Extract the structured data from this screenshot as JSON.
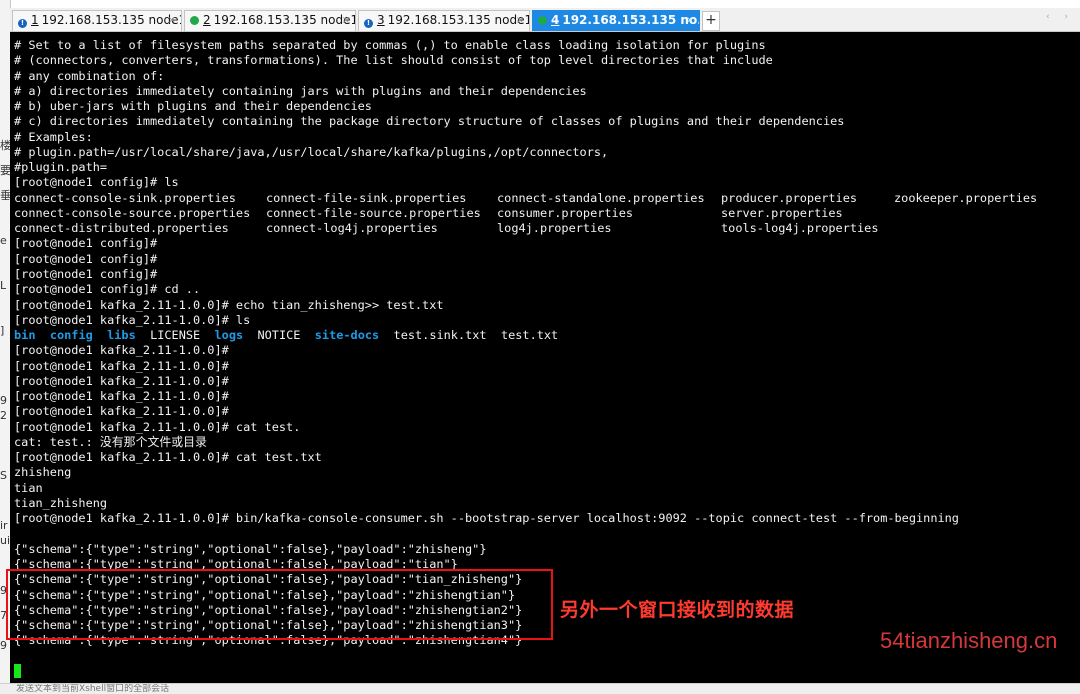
{
  "tabs": [
    {
      "num": "1",
      "label": "192.168.153.135 node1",
      "status": "info",
      "close": "×"
    },
    {
      "num": "2",
      "label": "192.168.153.135 node1",
      "status": "ok",
      "close": "×"
    },
    {
      "num": "3",
      "label": "192.168.153.135 node1",
      "status": "info",
      "close": "×"
    },
    {
      "num": "4",
      "label": "192.168.153.135 no...",
      "status": "ok",
      "close": "×",
      "active": true
    }
  ],
  "add_tab": "+",
  "tab_nav": "‹ ›",
  "left_strip_glyphs": [
    "楼",
    "要",
    "垂",
    "e",
    "L",
    "]",
    "9",
    "2",
    "S",
    "ir",
    "ui",
    "9",
    "7",
    "9"
  ],
  "terminal": {
    "lines_top": [
      "# Set to a list of filesystem paths separated by commas (,) to enable class loading isolation for plugins",
      "# (connectors, converters, transformations). The list should consist of top level directories that include",
      "# any combination of:",
      "# a) directories immediately containing jars with plugins and their dependencies",
      "# b) uber-jars with plugins and their dependencies",
      "# c) directories immediately containing the package directory structure of classes of plugins and their dependencies",
      "# Examples:",
      "# plugin.path=/usr/local/share/java,/usr/local/share/kafka/plugins,/opt/connectors,",
      "#plugin.path=",
      "[root@node1 config]# ls"
    ],
    "ls_rows": [
      [
        "connect-console-sink.properties",
        "connect-file-sink.properties",
        "connect-standalone.properties",
        "producer.properties",
        "zookeeper.properties"
      ],
      [
        "connect-console-source.properties",
        "connect-file-source.properties",
        "consumer.properties",
        "server.properties",
        ""
      ],
      [
        "connect-distributed.properties",
        "connect-log4j.properties",
        "log4j.properties",
        "tools-log4j.properties",
        ""
      ]
    ],
    "lines_mid": [
      "[root@node1 config]#",
      "[root@node1 config]#",
      "[root@node1 config]#",
      "[root@node1 config]# cd ..",
      "[root@node1 kafka_2.11-1.0.0]# echo tian_zhisheng>> test.txt",
      "[root@node1 kafka_2.11-1.0.0]# ls"
    ],
    "ls_kafka": [
      {
        "text": "bin",
        "dir": true
      },
      {
        "text": "config",
        "dir": true
      },
      {
        "text": "libs",
        "dir": true
      },
      {
        "text": "LICENSE",
        "dir": false
      },
      {
        "text": "logs",
        "dir": true
      },
      {
        "text": "NOTICE",
        "dir": false
      },
      {
        "text": "site-docs",
        "dir": true
      },
      {
        "text": "test.sink.txt",
        "dir": false
      },
      {
        "text": "test.txt",
        "dir": false
      }
    ],
    "lines_bottom": [
      "[root@node1 kafka_2.11-1.0.0]#",
      "[root@node1 kafka_2.11-1.0.0]#",
      "[root@node1 kafka_2.11-1.0.0]#",
      "[root@node1 kafka_2.11-1.0.0]#",
      "[root@node1 kafka_2.11-1.0.0]#",
      "[root@node1 kafka_2.11-1.0.0]# cat test.",
      "cat: test.: 没有那个文件或目录",
      "[root@node1 kafka_2.11-1.0.0]# cat test.txt",
      "zhisheng",
      "tian",
      "tian_zhisheng",
      "[root@node1 kafka_2.11-1.0.0]# bin/kafka-console-consumer.sh --bootstrap-server localhost:9092 --topic connect-test --from-beginning",
      "",
      "{\"schema\":{\"type\":\"string\",\"optional\":false},\"payload\":\"zhisheng\"}",
      "{\"schema\":{\"type\":\"string\",\"optional\":false},\"payload\":\"tian\"}",
      "{\"schema\":{\"type\":\"string\",\"optional\":false},\"payload\":\"tian_zhisheng\"}",
      "{\"schema\":{\"type\":\"string\",\"optional\":false},\"payload\":\"zhishengtian\"}",
      "{\"schema\":{\"type\":\"string\",\"optional\":false},\"payload\":\"zhishengtian2\"}",
      "{\"schema\":{\"type\":\"string\",\"optional\":false},\"payload\":\"zhishengtian3\"}",
      "{\"schema\":{\"type\":\"string\",\"optional\":false},\"payload\":\"zhishengtian4\"}"
    ]
  },
  "annotation": "另外一个窗口接收到的数据",
  "watermark": "54tianzhisheng.cn",
  "bottom_strip": "发送文本到当前Xshell窗口的全部会话",
  "colors": {
    "terminal_bg": "#000000",
    "terminal_fg": "#f2f2f2",
    "dir_color": "#1e9be8",
    "active_tab": "#1e88e5",
    "annotation_red": "#ff3b2f",
    "cursor_green": "#19e619"
  }
}
